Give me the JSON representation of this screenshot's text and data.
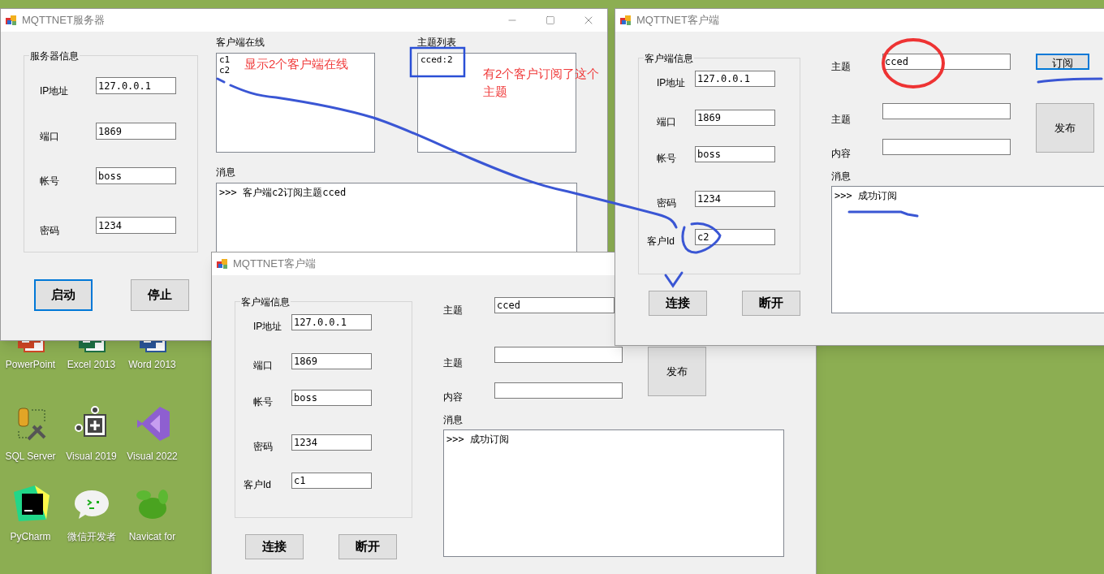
{
  "desktop_icons": [
    {
      "kind": "powerpoint",
      "label": "PowerPoint"
    },
    {
      "kind": "excel",
      "label": "Excel 2013"
    },
    {
      "kind": "word",
      "label": "Word 2013"
    },
    {
      "kind": "sqlserver",
      "label": "SQL Server"
    },
    {
      "kind": "plugin",
      "label": "Visual 2019"
    },
    {
      "kind": "vs",
      "label": "Visual 2022"
    },
    {
      "kind": "pycharm",
      "label": "PyCharm"
    },
    {
      "kind": "wechatdev",
      "label": "微信开发者"
    },
    {
      "kind": "navicat",
      "label": "Navicat for"
    }
  ],
  "windows": [
    {
      "kind": "server",
      "title": "MQTTNET服务器",
      "group_title": "服务器信息",
      "fields": [
        {
          "label": "IP地址",
          "value": "127.0.0.1"
        },
        {
          "label": "端口",
          "value": "1869"
        },
        {
          "label": "帐号",
          "value": "boss"
        },
        {
          "label": "密码",
          "value": "1234"
        }
      ],
      "buttons": [
        {
          "label": "启动",
          "focused": true
        },
        {
          "label": "停止",
          "focused": false
        }
      ],
      "online_clients": {
        "label": "客户端在线",
        "items": [
          "c1",
          "c2"
        ],
        "note": "显示2个客户端在线"
      },
      "topic_list": {
        "label": "主题列表",
        "items": [
          "cced:2"
        ],
        "note": "有2个客户订阅了这个主题"
      },
      "messages": {
        "label": "消息",
        "lines": [
          ">>> 客户端c2订阅主题cced"
        ]
      }
    },
    {
      "kind": "client",
      "title": "MQTTNET客户端",
      "group_title": "客户端信息",
      "fields": [
        {
          "label": "IP地址",
          "value": "127.0.0.1"
        },
        {
          "label": "端口",
          "value": "1869"
        },
        {
          "label": "帐号",
          "value": "boss"
        },
        {
          "label": "密码",
          "value": "1234"
        },
        {
          "label": "客户Id",
          "value": "c1"
        }
      ],
      "buttons": [
        {
          "label": "连接",
          "focused": false
        },
        {
          "label": "断开",
          "focused": false
        }
      ],
      "subscribe": {
        "label": "主题",
        "value": "cced"
      },
      "publish": {
        "topic_label": "主题",
        "content_label": "内容",
        "button": "发布"
      },
      "messages": {
        "label": "消息",
        "lines": [
          ">>> 成功订阅"
        ]
      }
    },
    {
      "kind": "client",
      "title": "MQTTNET客户端",
      "group_title": "客户端信息",
      "fields": [
        {
          "label": "IP地址",
          "value": "127.0.0.1"
        },
        {
          "label": "端口",
          "value": "1869"
        },
        {
          "label": "帐号",
          "value": "boss"
        },
        {
          "label": "密码",
          "value": "1234"
        },
        {
          "label": "客户Id",
          "value": "c2"
        }
      ],
      "buttons": [
        {
          "label": "连接",
          "focused": false
        },
        {
          "label": "断开",
          "focused": false
        }
      ],
      "subscribe": {
        "label": "主题",
        "value": "cced",
        "button": {
          "label": "订阅",
          "focused": true
        }
      },
      "publish": {
        "topic_label": "主题",
        "content_label": "内容",
        "button": "发布"
      },
      "messages": {
        "label": "消息",
        "lines": [
          ">>> 成功订阅"
        ]
      }
    }
  ]
}
